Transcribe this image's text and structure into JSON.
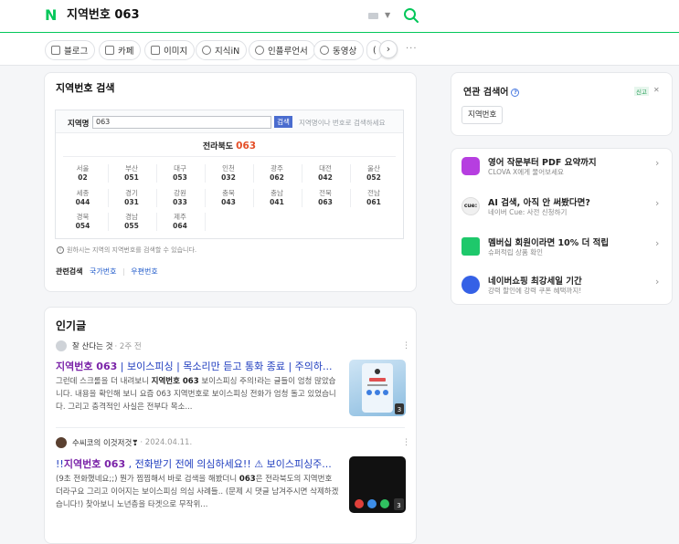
{
  "header": {
    "query": "지역번호 063"
  },
  "tabs": [
    {
      "label": "블로그"
    },
    {
      "label": "카페"
    },
    {
      "label": "이미지"
    },
    {
      "label": "지식iN"
    },
    {
      "label": "인플루언서"
    },
    {
      "label": "동영상"
    },
    {
      "label": "("
    }
  ],
  "area_code": {
    "title": "지역번호 검색",
    "input_label": "지역명",
    "input_value": "063",
    "search_button": "검색",
    "hint": "지역명이나 번호로 검색하세요",
    "result_region": "전라북도",
    "result_code": "063",
    "regions": [
      {
        "name": "서울",
        "code": "02"
      },
      {
        "name": "부산",
        "code": "051"
      },
      {
        "name": "대구",
        "code": "053"
      },
      {
        "name": "인천",
        "code": "032"
      },
      {
        "name": "광주",
        "code": "062"
      },
      {
        "name": "대전",
        "code": "042"
      },
      {
        "name": "울산",
        "code": "052"
      },
      {
        "name": "세종",
        "code": "044"
      },
      {
        "name": "경기",
        "code": "031"
      },
      {
        "name": "강원",
        "code": "033"
      },
      {
        "name": "충북",
        "code": "043"
      },
      {
        "name": "충남",
        "code": "041"
      },
      {
        "name": "전북",
        "code": "063"
      },
      {
        "name": "전남",
        "code": "061"
      },
      {
        "name": "경북",
        "code": "054"
      },
      {
        "name": "경남",
        "code": "055"
      },
      {
        "name": "제주",
        "code": "064"
      }
    ],
    "note": "원하시는 지역의 지역번호를 검색할 수 있습니다.",
    "related_label": "관련검색",
    "related_links": [
      "국가번호",
      "우편번호"
    ]
  },
  "popular": {
    "title": "인기글",
    "posts": [
      {
        "author": "잘 산다는 것",
        "meta": "· 2주 전",
        "title_bold": "지역번호 063",
        "title_rest": " | 보이스피싱 | 목소리만 듣고 통화 종료 | 주의하...",
        "desc_pre": "그런데 스크롤을 더 내려보니 ",
        "desc_bold": "지역번호 063",
        "desc_post": " 보이스피싱 주의!라는 글들이 엄청 많았습니다. 내용을 확인해 보니 요즘 063 지역번호로 보이스피싱 전화가 엄청 돌고 있었습니다. 그리고 충격적인 사실은 전부다 목소...",
        "thumb_count": "3"
      },
      {
        "author": "수씨코의 이것저것❣",
        "meta": "· 2024.04.11.",
        "title_pre": "!!",
        "title_bold": "지역번호 063",
        "title_rest": " , 전화받기 전에 의심하세요!! ⚠ 보이스피싱주...",
        "desc_pre": "(9초 전화했네요;;) 뭔가 찜찜해서 바로 검색을 해봤더니 ",
        "desc_bold": "063",
        "desc_post": "은 전라북도의 지역번호더라구요 그리고 이어지는 보이스피싱 의심 사례들.. (문제 시 댓글 남겨주시면 삭제하겠습니다!) 찾아보니 노년층을 타겟으로 무작위...",
        "thumb_count": "3"
      }
    ]
  },
  "related_search": {
    "title": "연관 검색어",
    "report": "신고",
    "chip": "지역번호"
  },
  "promos": [
    {
      "title": "영어 작문부터 PDF 요약까지",
      "sub": "CLOVA X에게 물어보세요",
      "color": "#b63ee0"
    },
    {
      "title": "AI 검색, 아직 안 써봤다면?",
      "sub": "네이버 Cue: 사전 신청하기",
      "color": "#222222"
    },
    {
      "title": "멤버십 회원이라면 10% 더 적립",
      "sub": "슈퍼적립 상품 확인",
      "color": "#1ec86b"
    },
    {
      "title": "네이버쇼핑 최강세일 기간",
      "sub": "강력 할인에 강력 쿠폰 혜택까지!",
      "color": "#3561e6"
    }
  ]
}
